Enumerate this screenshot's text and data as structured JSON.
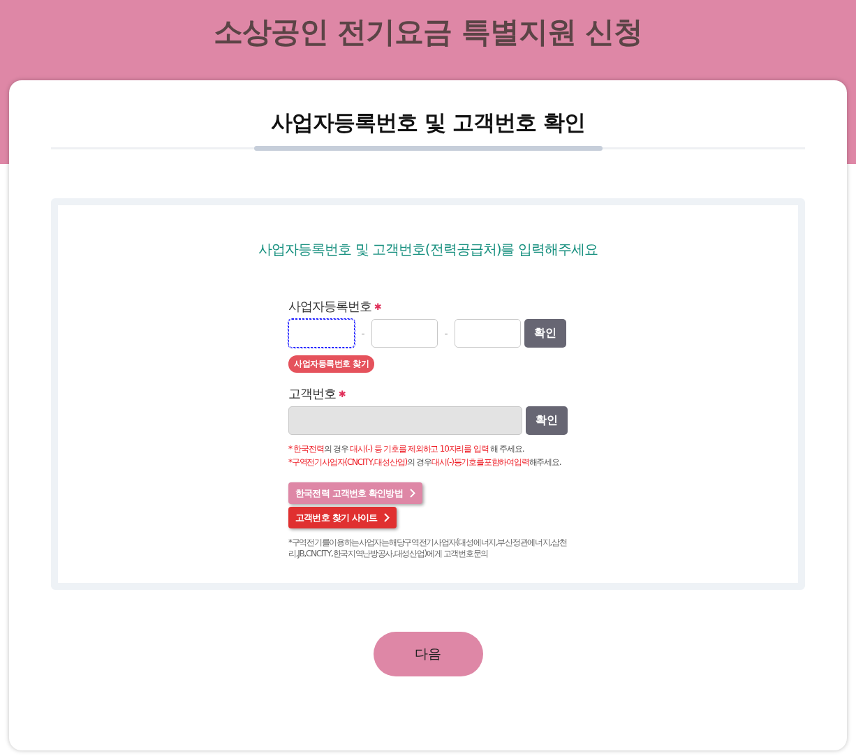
{
  "header": {
    "title": "소상공인 전기요금 특별지원 신청"
  },
  "card": {
    "title": "사업자등록번호 및 고객번호 확인"
  },
  "panel": {
    "subtitle": "사업자등록번호 및 고객번호(전력공급처)를 입력해주세요",
    "business": {
      "label": "사업자등록번호",
      "required": "✱",
      "parts": [
        {
          "focused": true
        },
        {
          "focused": false
        },
        {
          "focused": false
        }
      ],
      "separators": [
        "-",
        "-"
      ],
      "confirm": "확인",
      "find": "사업자등록번호 찾기"
    },
    "customer": {
      "label": "고객번호",
      "required": "✱",
      "disabled": true,
      "confirm": "확인",
      "notes": [
        [
          {
            "text": "* 한국전력",
            "highlight": true
          },
          {
            "text": "의 경우 ",
            "highlight": false
          },
          {
            "text": "대시(-) 등 기호를 제외하고 10자리를 입력",
            "highlight": true
          },
          {
            "text": " 해 주세요.",
            "highlight": false
          }
        ],
        [
          {
            "text": "*구역전기사업자(CNCITY,대성산업)",
            "highlight": true
          },
          {
            "text": "의 경우",
            "highlight": false
          },
          {
            "text": "대시(-)등기호를포함하여입력",
            "highlight": true
          },
          {
            "text": "해주세요.",
            "highlight": false
          }
        ]
      ],
      "links": [
        {
          "label": "한국전력 고객번호 확인방법",
          "color": "#de87a6"
        },
        {
          "label": "고객번호 찾기 사이트",
          "color": "#e03030"
        }
      ],
      "footnote": "*구역전기를이용하는사업자는해당구역전기사업자(대성에너지,부산정관에너지,삼천리,JB,CNCITY,한국지역난방공사,대성산업)에게 고객번호문의"
    }
  },
  "next": "다음"
}
